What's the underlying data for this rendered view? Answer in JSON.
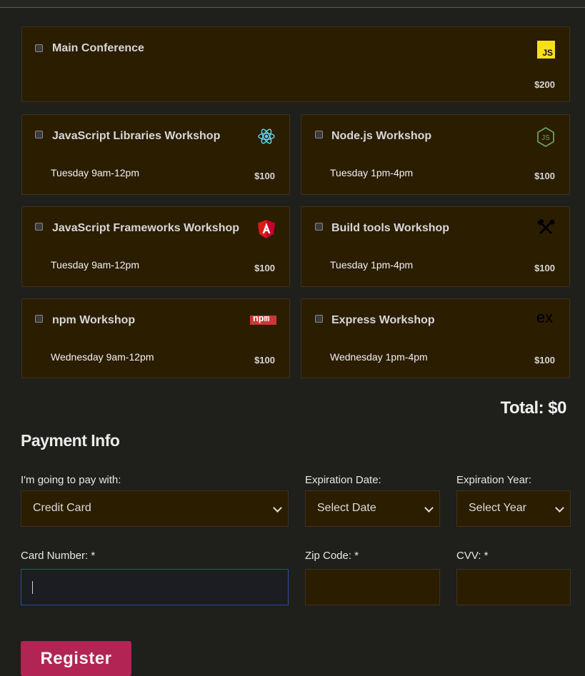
{
  "activities": [
    {
      "name": "Main Conference",
      "time": "",
      "price": "$200",
      "icon": "js-icon"
    },
    {
      "name": "JavaScript Libraries Workshop",
      "time": "Tuesday 9am-12pm",
      "price": "$100",
      "icon": "react-icon"
    },
    {
      "name": "Node.js Workshop",
      "time": "Tuesday 1pm-4pm",
      "price": "$100",
      "icon": "nodejs-icon"
    },
    {
      "name": "JavaScript Frameworks Workshop",
      "time": "Tuesday 9am-12pm",
      "price": "$100",
      "icon": "angular-icon"
    },
    {
      "name": "Build tools Workshop",
      "time": "Tuesday 1pm-4pm",
      "price": "$100",
      "icon": "tools-icon"
    },
    {
      "name": "npm Workshop",
      "time": "Wednesday 9am-12pm",
      "price": "$100",
      "icon": "npm-icon"
    },
    {
      "name": "Express Workshop",
      "time": "Wednesday 1pm-4pm",
      "price": "$100",
      "icon": "express-icon"
    }
  ],
  "icon_text": {
    "js": "JS",
    "npm": "npm",
    "express": "ex"
  },
  "total": "Total: $0",
  "payment": {
    "heading": "Payment Info",
    "pay_with_label": "I'm going to pay with:",
    "pay_with_value": "Credit Card",
    "exp_date_label": "Expiration Date:",
    "exp_date_value": "Select Date",
    "exp_year_label": "Expiration Year:",
    "exp_year_value": "Select Year",
    "card_number_label": "Card Number: *",
    "zip_label": "Zip Code: *",
    "cvv_label": "CVV: *"
  },
  "register_label": "Register",
  "colors": {
    "card_bg": "#2b1d00",
    "page_bg": "#1f1f1c",
    "register_bg": "#b22454",
    "js_yellow": "#f7df1e",
    "react_cyan": "#61dafb",
    "angular_red": "#dd1b16",
    "npm_red": "#cb3837"
  }
}
